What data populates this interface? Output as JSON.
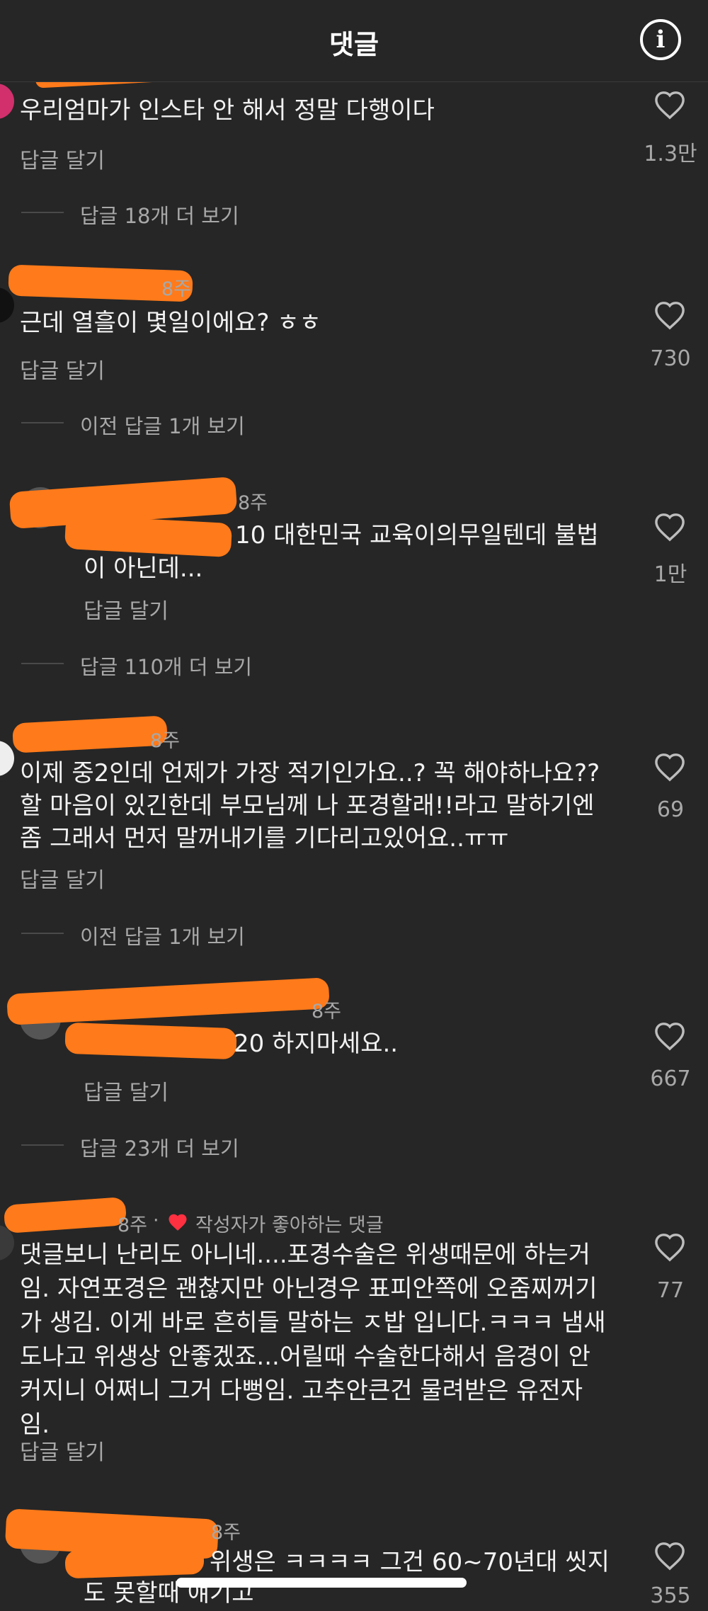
{
  "header": {
    "title": "댓글",
    "info_icon_glyph": "i"
  },
  "labels": {
    "reply": "답글 달기"
  },
  "comments": [
    {
      "time": "",
      "text_lines": [
        "우리엄마가 인스타 안 해서 정말 다행이다"
      ],
      "likes": "1.3만",
      "more": "답글 18개 더 보기"
    },
    {
      "time": "8주",
      "text_lines": [
        "근데 열흘이 몇일이에요? ㅎㅎ"
      ],
      "likes": "730",
      "more": "이전 답글 1개 보기"
    },
    {
      "time": "8주",
      "text_lines": [
        "10 대한민국 교육이의무일텐데 불법",
        "이 아닌데..."
      ],
      "likes": "1만",
      "more": "답글 110개 더 보기"
    },
    {
      "time": "8주",
      "text_lines": [
        "이제 중2인데 언제가 가장 적기인가요..? 꼭 해야하나요??",
        "할 마음이 있긴한데 부모님께 나 포경할래!!라고 말하기엔",
        "좀 그래서 먼저 말꺼내기를 기다리고있어요..ㅠㅠ"
      ],
      "likes": "69",
      "more": "이전 답글 1개 보기"
    },
    {
      "time": "8주",
      "text_lines": [
        "20 하지마세요.."
      ],
      "likes": "667",
      "more": "답글 23개 더 보기"
    },
    {
      "time": "8주",
      "creator_liked": "작성자가 좋아하는 댓글",
      "text_lines": [
        "댓글보니 난리도 아니네....포경수술은 위생때문에 하는거",
        "임. 자연포경은 괜찮지만 아닌경우 표피안쪽에 오줌찌꺼기",
        "가 생김. 이게 바로 흔히들 말하는 ㅈ밥 입니다.ㅋㅋㅋ 냄새",
        "도나고 위생상 안좋겠죠...어릴때 수술한다해서 음경이 안",
        "커지니 어쩌니 그거 다뻥임. 고추안큰건 물려받은 유전자",
        "임."
      ],
      "likes": "77"
    },
    {
      "time": "8주",
      "text_lines": [
        "위생은 ㅋㅋㅋㅋ 그건 60~70년대 씻지",
        "도 못할때 얘기고"
      ],
      "likes": "355"
    }
  ],
  "colors": {
    "background": "#262626",
    "redaction": "#ff7a1a",
    "heart_red": "#ff3040",
    "muted": "#a8a8a8"
  }
}
